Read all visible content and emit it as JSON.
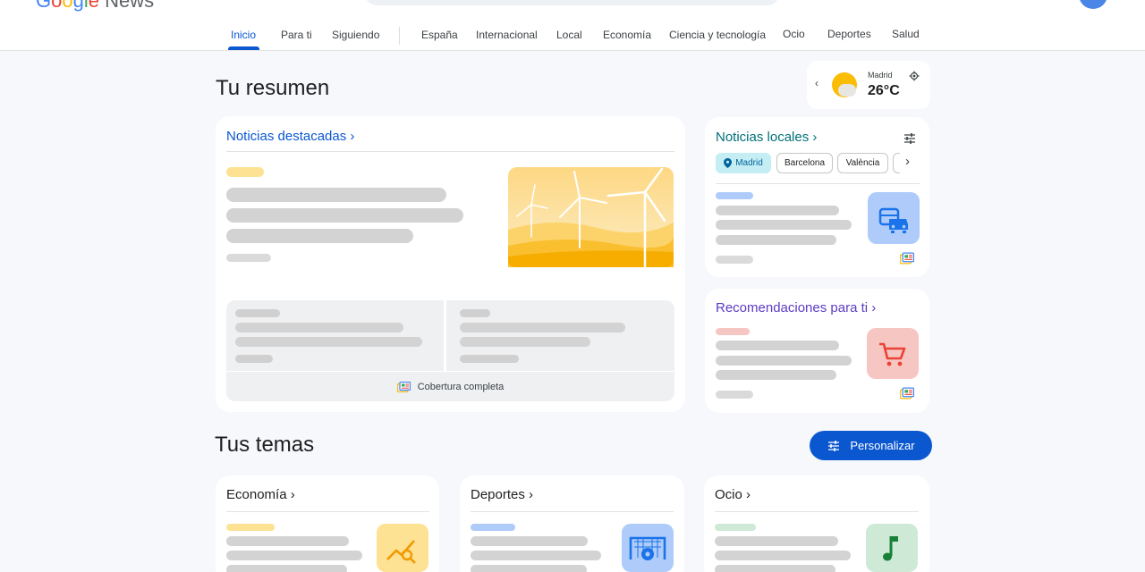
{
  "header": {
    "logo_text": "Google News",
    "nav": [
      {
        "label": "Inicio",
        "active": true
      },
      {
        "label": "Para ti"
      },
      {
        "label": "Siguiendo"
      },
      {
        "label": "España"
      },
      {
        "label": "Internacional"
      },
      {
        "label": "Local"
      },
      {
        "label": "Economía"
      },
      {
        "label": "Ciencia y tecnología"
      },
      {
        "label": "Ocio"
      },
      {
        "label": "Deportes"
      },
      {
        "label": "Salud"
      }
    ]
  },
  "summary": {
    "title": "Tu resumen",
    "weather": {
      "city": "Madrid",
      "temp": "26°C",
      "icon": "sun-cloud-icon"
    }
  },
  "top_stories": {
    "title": "Noticias destacadas",
    "coverage_label": "Cobertura completa",
    "image_icon": "wind-turbines-image"
  },
  "local": {
    "title": "Noticias locales",
    "chips": [
      "Madrid",
      "Barcelona",
      "València"
    ],
    "selected_chip": "Madrid",
    "thumb_icon": "car-bus-icon"
  },
  "recommendations": {
    "title": "Recomendaciones para ti",
    "thumb_icon": "shopping-cart-icon"
  },
  "topics": {
    "title": "Tus temas",
    "personalize_label": "Personalizar",
    "cards": [
      {
        "title": "Economía",
        "thumb_icon": "chart-search-icon"
      },
      {
        "title": "Deportes",
        "thumb_icon": "soccer-goal-icon"
      },
      {
        "title": "Ocio",
        "thumb_icon": "music-note-icon"
      }
    ]
  },
  "colors": {
    "accent": "#0b57d0",
    "local_title": "#00707a",
    "recommend_title": "#5b3cc4",
    "background": "#f6f8fc"
  }
}
